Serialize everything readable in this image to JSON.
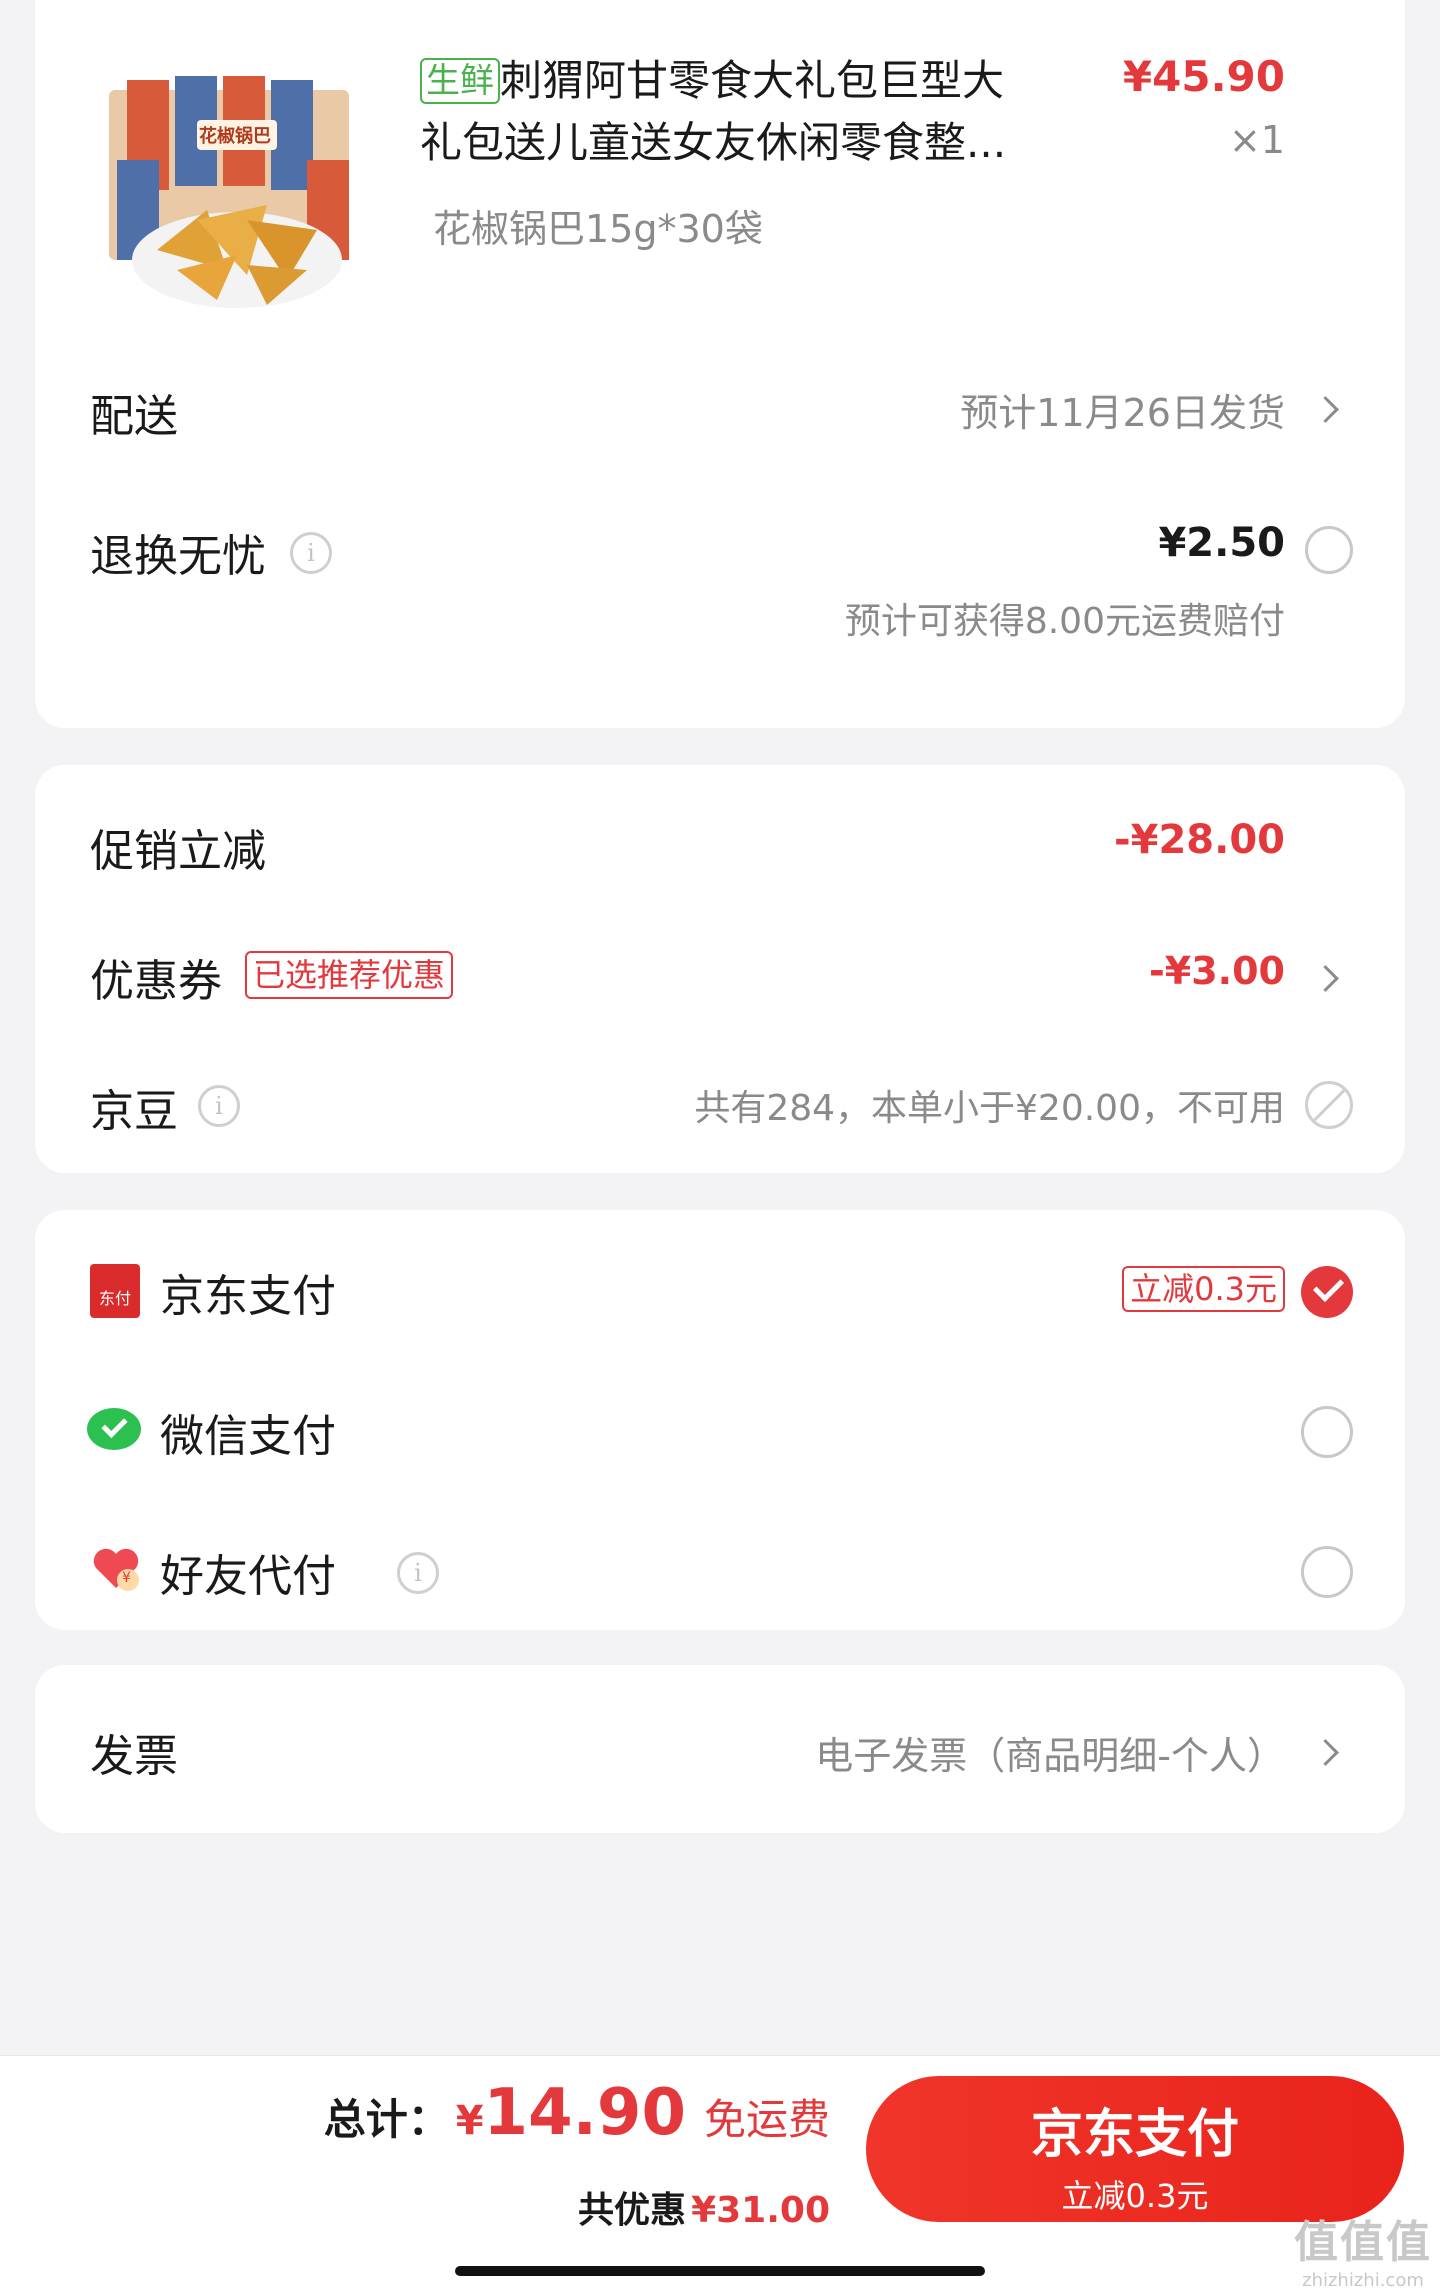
{
  "product": {
    "tag": "生鲜",
    "title_line1": "刺猬阿甘零食大礼包巨型大",
    "title_line2": "礼包送儿童送女友休闲零食整...",
    "spec": "花椒锅巴15g*30袋",
    "price": "¥45.90",
    "quantity": "×1",
    "image_text": "花椒锅巴"
  },
  "delivery": {
    "label": "配送",
    "value": "预计11月26日发货"
  },
  "return_service": {
    "label": "退换无忧",
    "price": "¥2.50",
    "note": "预计可获得8.00元运费赔付"
  },
  "promotions": {
    "promo_label": "促销立减",
    "promo_value": "-¥28.00",
    "coupon_label": "优惠券",
    "coupon_tag": "已选推荐优惠",
    "coupon_value": "-¥3.00",
    "beans_label": "京豆",
    "beans_value": "共有284，本单小于¥20.00，不可用"
  },
  "payment": {
    "jd_icon_text": "东付",
    "jd_label": "京东支付",
    "jd_tag": "立减0.3元",
    "wechat_label": "微信支付",
    "friend_label": "好友代付",
    "friend_icon_text": "¥"
  },
  "invoice": {
    "label": "发票",
    "value": "电子发票（商品明细-个人）"
  },
  "footer": {
    "total_label": "总计：",
    "currency": "¥",
    "total": "14.90",
    "free_shipping": "免运费",
    "discount_label": "共优惠",
    "discount_value": "¥31.00",
    "pay_button": "京东支付",
    "pay_sub": "立减0.3元"
  },
  "watermark": {
    "text": "值值值",
    "sub": "zhizhizhi.com"
  },
  "colors": {
    "accent": "#e4393c",
    "green": "#4bb14e",
    "background": "#f3f3f5"
  }
}
